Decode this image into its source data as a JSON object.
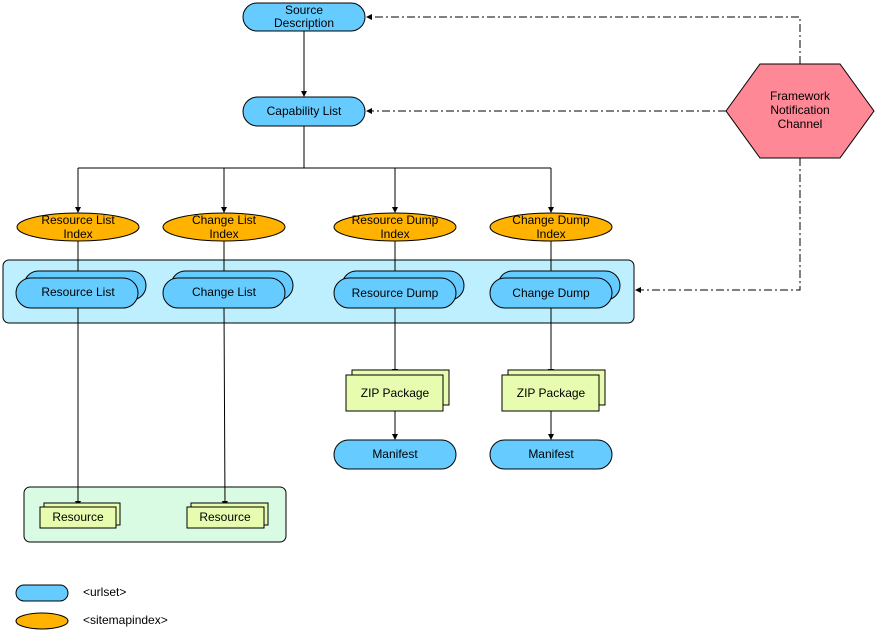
{
  "nodes": {
    "source_description": [
      "Source",
      "Description"
    ],
    "capability_list": "Capability List",
    "indexes": [
      [
        "Resource List",
        "Index"
      ],
      [
        "Change List",
        "Index"
      ],
      [
        "Resource Dump",
        "Index"
      ],
      [
        "Change Dump",
        "Index"
      ]
    ],
    "lists": [
      "Resource List",
      "Change List",
      "Resource Dump",
      "Change Dump"
    ],
    "zip_packages": [
      "ZIP Package",
      "ZIP Package"
    ],
    "manifests": [
      "Manifest",
      "Manifest"
    ],
    "resources": [
      "Resource",
      "Resource"
    ],
    "framework": [
      "Framework",
      "Notification",
      "Channel"
    ]
  },
  "legend": {
    "urlset": "<urlset>",
    "sitemapindex": "<sitemapindex>"
  },
  "colors": {
    "urlset": "#66ccff",
    "sitemapindex": "#ffb300",
    "list_container": "#bdefff",
    "resource_container": "#d9fbe3",
    "package": "#e8fcb0",
    "framework": "#ff8896"
  }
}
